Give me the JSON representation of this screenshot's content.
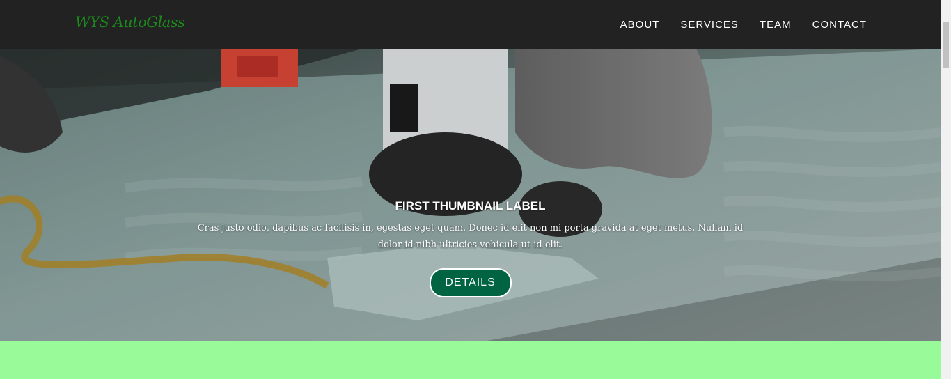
{
  "navbar": {
    "brand": "WYS AutoGlass",
    "links": [
      "ABOUT",
      "SERVICES",
      "TEAM",
      "CONTACT"
    ]
  },
  "hero": {
    "image": "windshield-repair-photo",
    "title": "FIRST THUMBNAIL LABEL",
    "text": "Cras justo odio, dapibus ac facilisis in, egestas eget quam. Donec id elit non mi porta gravida at eget metus. Nullam id dolor id nibh ultricies vehicula ut id elit.",
    "button_label": "DETAILS"
  },
  "colors": {
    "navbar_bg": "#222222",
    "brand": "#1c8a1c",
    "button_bg": "#006342",
    "green_band": "#99fa99"
  }
}
